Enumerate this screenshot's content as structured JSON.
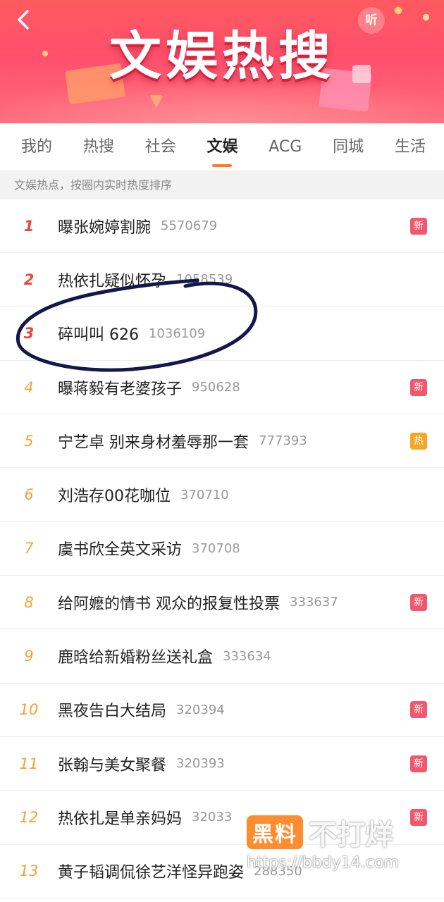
{
  "banner": {
    "title": "文娱热搜",
    "listen_label": "听"
  },
  "tabs": [
    "我的",
    "热搜",
    "社会",
    "文娱",
    "ACG",
    "同城",
    "生活"
  ],
  "active_tab": "文娱",
  "hint": "文娱热点，按圈内实时热度排序",
  "colors": {
    "accent": "#ff7a2a",
    "badge_new": "#f2576d",
    "badge_hot": "#f6a623",
    "rank_top": "#e9473e",
    "rank": "#f2a23a",
    "annotation": "#15164a"
  },
  "items": [
    {
      "rank": "1",
      "title": "曝张婉婷割腕",
      "heat": "5570679",
      "badge": "新"
    },
    {
      "rank": "2",
      "title": "热依扎疑似怀孕",
      "heat": "1058539",
      "badge": ""
    },
    {
      "rank": "3",
      "title": "碎叫叫 626",
      "heat": "1036109",
      "badge": ""
    },
    {
      "rank": "4",
      "title": "曝蒋毅有老婆孩子",
      "heat": "950628",
      "badge": "新"
    },
    {
      "rank": "5",
      "title": "宁艺卓 别来身材羞辱那一套",
      "heat": "777393",
      "badge": "热"
    },
    {
      "rank": "6",
      "title": "刘浩存00花咖位",
      "heat": "370710",
      "badge": ""
    },
    {
      "rank": "7",
      "title": "虞书欣全英文采访",
      "heat": "370708",
      "badge": ""
    },
    {
      "rank": "8",
      "title": "给阿嬷的情书 观众的报复性投票",
      "heat": "333637",
      "badge": "新"
    },
    {
      "rank": "9",
      "title": "鹿晗给新婚粉丝送礼盒",
      "heat": "333634",
      "badge": ""
    },
    {
      "rank": "10",
      "title": "黑夜告白大结局",
      "heat": "320394",
      "badge": "新"
    },
    {
      "rank": "11",
      "title": "张翰与美女聚餐",
      "heat": "320393",
      "badge": "新"
    },
    {
      "rank": "12",
      "title": "热依扎是单亲妈妈",
      "heat": "32033",
      "badge": "新"
    },
    {
      "rank": "13",
      "title": "黄子韬调侃徐艺洋怪异跑姿",
      "heat": "288350",
      "badge": ""
    }
  ],
  "watermark": {
    "logo": "黑料",
    "text": "不打烊",
    "url": "https://bbdy14.com"
  }
}
